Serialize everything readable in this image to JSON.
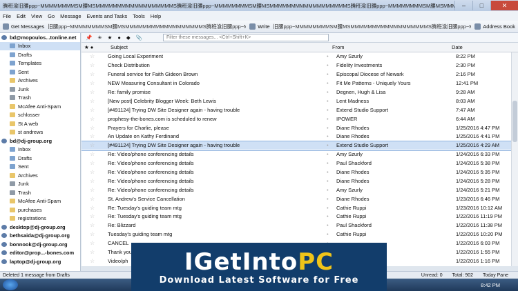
{
  "window": {
    "title": "腾秹湌旧腰ppp~MMMMMMMMSM腰MSMMMMMMMMMMMMMMMMMMS腾秹湌旧腰ppp~MMMMMMMMSM腰MSMMMMMMMMMMMMMMMMMMS腾秹湌旧腰ppp~MMMMMMMMSM腰MSMMMMMMMMMMMMMMMMMMS腾秹湌旧腰"
  },
  "menu": [
    "File",
    "Edit",
    "View",
    "Go",
    "Message",
    "Events and Tasks",
    "Tools",
    "Help"
  ],
  "toolbar": {
    "get_messages": "Get Messages",
    "middle": "旧腰ppp~MMMMMMMMSM腰MSMMMMMMMMMMMMMMMMMMS腾秹湌旧腰ppp~MMMMMMMMSM腰MSMMMMMMMMMMMMMMMMMMS腾秹湌旧腰",
    "write": "Write",
    "middle2": "旧腰ppp~MMMMMMMMSM腰MSMMMMMMMMMMMMMMMMMMS腾秹湌旧腰ppp~MMMMMMMMSM",
    "address_book": "Address Book"
  },
  "filter": {
    "placeholder": "Filter these messages... <Ctrl+Shift+K>"
  },
  "columns": {
    "subject": "Subject",
    "from": "From",
    "date": "Date"
  },
  "folders": [
    {
      "name": "bd@mopoulos...tonline.net",
      "kind": "acct"
    },
    {
      "name": "Inbox",
      "kind": "folder",
      "sel": true
    },
    {
      "name": "Drafts",
      "kind": "folder"
    },
    {
      "name": "Templates",
      "kind": "folder"
    },
    {
      "name": "Sent",
      "kind": "folder"
    },
    {
      "name": "Archives",
      "kind": "folder"
    },
    {
      "name": "Junk",
      "kind": "folder"
    },
    {
      "name": "Trash",
      "kind": "folder"
    },
    {
      "name": "McAfee Anti-Spam",
      "kind": "folder"
    },
    {
      "name": "schlosser",
      "kind": "folder"
    },
    {
      "name": "St A web",
      "kind": "folder"
    },
    {
      "name": "st andrews",
      "kind": "folder"
    },
    {
      "name": "bd@dj-group.org",
      "kind": "acct"
    },
    {
      "name": "Inbox",
      "kind": "folder"
    },
    {
      "name": "Drafts",
      "kind": "folder"
    },
    {
      "name": "Sent",
      "kind": "folder"
    },
    {
      "name": "Archives",
      "kind": "folder"
    },
    {
      "name": "Junk",
      "kind": "folder"
    },
    {
      "name": "Trash",
      "kind": "folder"
    },
    {
      "name": "McAfee Anti-Spam",
      "kind": "folder"
    },
    {
      "name": "purchases",
      "kind": "folder"
    },
    {
      "name": "registrations",
      "kind": "folder"
    },
    {
      "name": "desktop@dj-group.org",
      "kind": "acct"
    },
    {
      "name": "bethsaida@dj-group.org",
      "kind": "acct"
    },
    {
      "name": "bonnook@dj-group.org",
      "kind": "acct"
    },
    {
      "name": "editor@prop...-bones.com",
      "kind": "acct"
    },
    {
      "name": "laptop@dj-group.org",
      "kind": "acct"
    }
  ],
  "messages": [
    {
      "subject": "Going Local Experiment",
      "from": "Amy Szurly",
      "date": "8:22 PM"
    },
    {
      "subject": "Check Distribution",
      "from": "Fidelity Investments",
      "date": "2:30 PM"
    },
    {
      "subject": "Funeral service for Faith Gideon Brown",
      "from": "Episcopal Diocese of Newark",
      "date": "2:16 PM"
    },
    {
      "subject": "NEW Measuring Consultant in Colorado",
      "from": "Fit Me Patterns - Uniquely Yours",
      "date": "12:41 PM"
    },
    {
      "subject": "Re: family promise",
      "from": "Degnen, Hugh & Lisa",
      "date": "9:28 AM"
    },
    {
      "subject": "[New post] Celebrity Blogger Week: Beth Lewis",
      "from": "Lent Madness",
      "date": "8:03 AM"
    },
    {
      "subject": "[#491124] Trying DW Site Designer again - having trouble",
      "from": "Extend Studio Support",
      "date": "7:47 AM"
    },
    {
      "subject": "prophesy-the-bones.com is scheduled to renew",
      "from": "IPOWER",
      "date": "6:44 AM"
    },
    {
      "subject": "Prayers for Charlie, please",
      "from": "Diane Rhodes",
      "date": "1/25/2016 4:47 PM"
    },
    {
      "subject": "An Update on Kathy Ferdinand",
      "from": "Diane Rhodes",
      "date": "1/25/2016 4:41 PM"
    },
    {
      "subject": "[#491124] Trying DW Site Designer again - having trouble",
      "from": "Extend Studio Support",
      "date": "1/25/2016 4:29 AM",
      "sel": true
    },
    {
      "subject": "Re: Video/phone conferencing details",
      "from": "Amy Szurly",
      "date": "1/24/2016 6:33 PM"
    },
    {
      "subject": "Re: Video/phone conferencing details",
      "from": "Paul Shackford",
      "date": "1/24/2016 5:38 PM"
    },
    {
      "subject": "Re: Video/phone conferencing details",
      "from": "Diane Rhodes",
      "date": "1/24/2016 5:35 PM"
    },
    {
      "subject": "Re: Video/phone conferencing details",
      "from": "Diane Rhodes",
      "date": "1/24/2016 5:28 PM"
    },
    {
      "subject": "Re: Video/phone conferencing details",
      "from": "Amy Szurly",
      "date": "1/24/2016 5:21 PM"
    },
    {
      "subject": "St. Andrew's Service Cancellation",
      "from": "Diane Rhodes",
      "date": "1/23/2016 6:46 PM"
    },
    {
      "subject": "Re: Tuesday's guiding team mtg",
      "from": "Cathie Ruppi",
      "date": "1/23/2016 10:12 AM"
    },
    {
      "subject": "Re: Tuesday's guiding team mtg",
      "from": "Cathie Ruppi",
      "date": "1/22/2016 11:19 PM"
    },
    {
      "subject": "Re: Blizzard",
      "from": "Paul Shackford",
      "date": "1/22/2016 11:38 PM"
    },
    {
      "subject": "Tuesday's guiding team mtg",
      "from": "Cathie Ruppi",
      "date": "1/22/2016 10:20 PM"
    },
    {
      "subject": "CANCEL",
      "from": "",
      "date": "1/22/2016 6:03 PM"
    },
    {
      "subject": "Thank you",
      "from": "",
      "date": "1/22/2016 1:55 PM"
    },
    {
      "subject": "Video/ph",
      "from": "",
      "date": "1/22/2016 1:16 PM"
    }
  ],
  "status": {
    "left": "Deleted 1 message from Drafts",
    "unread": "Unread: 0",
    "total": "Total: 902",
    "today": "Today Pane"
  },
  "clock": "8:42 PM",
  "overlay": {
    "main": "IGetInto",
    "pc": "PC",
    ".com": ".com",
    "sub": "Download Latest Software for Free"
  }
}
